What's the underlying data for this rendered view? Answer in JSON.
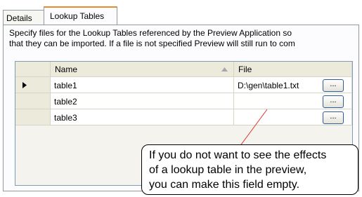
{
  "tabs": [
    {
      "label": "Details"
    },
    {
      "label": "Lookup Tables"
    }
  ],
  "description": {
    "line1": "Specify files for the Lookup Tables referenced by the Preview Application so",
    "line2": "that they can be imported. If a file is not specified Preview will still run to com"
  },
  "table": {
    "columns": {
      "name": "Name",
      "file": "File"
    },
    "sort_icon": "sort-ascending-icon",
    "rows": [
      {
        "name": "table1",
        "file": "D:\\gen\\table1.txt",
        "browse": "...",
        "current": true
      },
      {
        "name": "table2",
        "file": "",
        "browse": "...",
        "current": false
      },
      {
        "name": "table3",
        "file": "",
        "browse": "...",
        "current": false
      }
    ]
  },
  "callout": {
    "line1": "If you do not want to see the effects",
    "line2": "of a lookup table in the preview,",
    "line3": "you can make this field empty."
  },
  "colors": {
    "active_tab_accent": "#e68b2c",
    "callout_line": "#e0302a"
  }
}
